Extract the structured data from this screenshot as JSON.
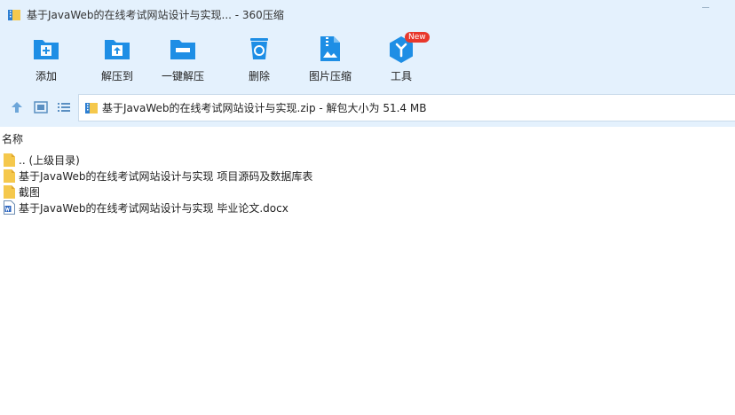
{
  "window": {
    "title": "基于JavaWeb的在线考试网站设计与实现... - 360压缩"
  },
  "toolbar": {
    "items": [
      {
        "label": "添加",
        "icon": "add-icon"
      },
      {
        "label": "解压到",
        "icon": "extract-to-icon"
      },
      {
        "label": "一键解压",
        "icon": "one-click-extract-icon"
      },
      {
        "label": "删除",
        "icon": "delete-icon"
      },
      {
        "label": "图片压缩",
        "icon": "image-compress-icon"
      },
      {
        "label": "工具",
        "icon": "tools-icon",
        "badge": "New"
      }
    ]
  },
  "nav": {
    "path": "基于JavaWeb的在线考试网站设计与实现.zip - 解包大小为 51.4 MB"
  },
  "list": {
    "column_name": "名称",
    "items": [
      {
        "name": ".. (上级目录)",
        "type": "folder"
      },
      {
        "name": "基于JavaWeb的在线考试网站设计与实现 项目源码及数据库表",
        "type": "folder"
      },
      {
        "name": "截图",
        "type": "folder"
      },
      {
        "name": "基于JavaWeb的在线考试网站设计与实现 毕业论文.docx",
        "type": "docx"
      }
    ]
  },
  "colors": {
    "toolbar_bg": "#e4f1fd",
    "icon_blue": "#1e8ee5",
    "folder_yellow": "#f5c84c",
    "badge_red": "#e8382c"
  }
}
